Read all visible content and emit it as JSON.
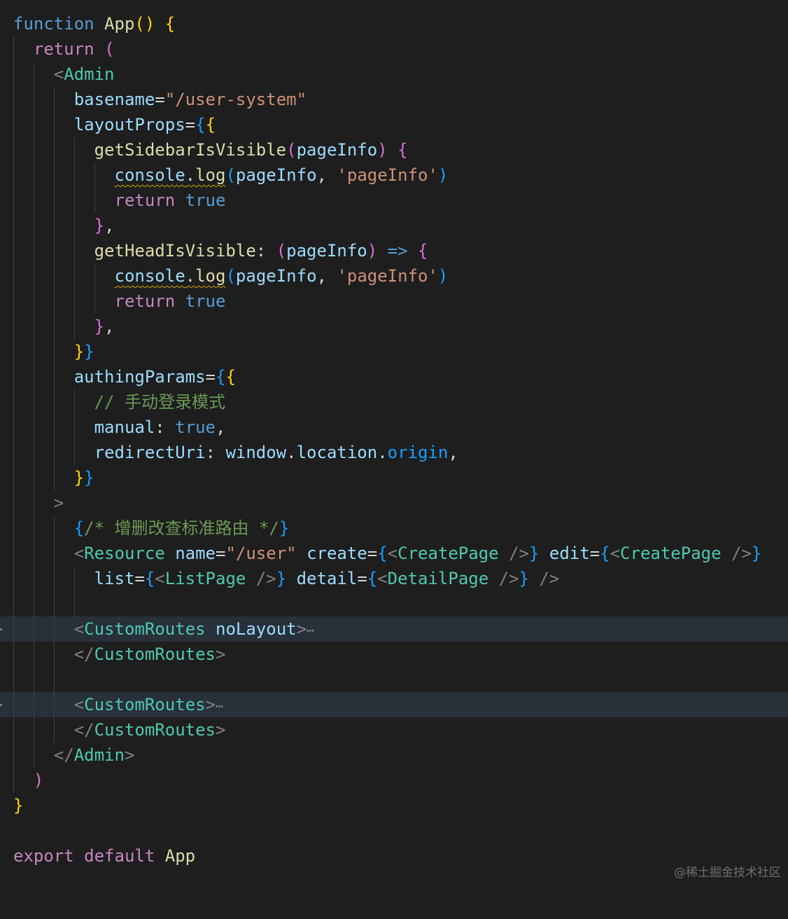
{
  "editor": {
    "language": "jsx",
    "theme": "dark",
    "line_1": {
      "kw": "function",
      "name": "App",
      "parens": "()",
      "brace": "{"
    },
    "line_2": {
      "kw": "return",
      "paren": "("
    },
    "line_3": {
      "lt": "<",
      "tag": "Admin"
    },
    "line_4": {
      "attr": "basename",
      "eq": "=",
      "value": "\"/user-system\""
    },
    "line_5": {
      "attr": "layoutProps",
      "eq": "=",
      "b1": "{",
      "b2": "{"
    },
    "line_6": {
      "name": "getSidebarIsVisible",
      "open": "(",
      "param": "pageInfo",
      "close": ")",
      "brace": "{"
    },
    "line_7": {
      "obj": "console",
      "dot": ".",
      "method": "log",
      "open": "(",
      "arg": "pageInfo",
      "comma": ",",
      "str": "'pageInfo'",
      "close": ")"
    },
    "line_8": {
      "kw": "return",
      "value": "true"
    },
    "line_9": {
      "brace": "}",
      "comma": ","
    },
    "line_10": {
      "name": "getHeadIsVisible",
      "colon": ":",
      "open": "(",
      "param": "pageInfo",
      "close": ")",
      "arrow": "=>",
      "brace": "{"
    },
    "line_11": {
      "obj": "console",
      "dot": ".",
      "method": "log",
      "open": "(",
      "arg": "pageInfo",
      "comma": ",",
      "str": "'pageInfo'",
      "close": ")"
    },
    "line_12": {
      "kw": "return",
      "value": "true"
    },
    "line_13": {
      "brace": "}",
      "comma": ","
    },
    "line_14": {
      "b1": "}",
      "b2": "}"
    },
    "line_15": {
      "attr": "authingParams",
      "eq": "=",
      "b1": "{",
      "b2": "{"
    },
    "line_16": {
      "comment": "// 手动登录模式"
    },
    "line_17": {
      "key": "manual",
      "colon": ":",
      "value": "true",
      "comma": ","
    },
    "line_18": {
      "key": "redirectUri",
      "colon": ":",
      "obj": "window",
      "dot1": ".",
      "prop1": "location",
      "dot2": ".",
      "prop2": "origin",
      "comma": ","
    },
    "line_19": {
      "b1": "}",
      "b2": "}"
    },
    "line_20": {
      "gt": ">"
    },
    "line_21": {
      "open": "{",
      "comment": "/* 增删改查标准路由 */",
      "close": "}"
    },
    "line_22": {
      "lt": "<",
      "tag": "Resource",
      "attr1": "name",
      "eq1": "=",
      "val1": "\"/user\"",
      "attr2": "create",
      "eq2": "=",
      "c_open": "{",
      "c_lt": "<",
      "c_tag": "CreatePage",
      "c_end": "/>",
      "c_close": "}",
      "attr3": "edit",
      "eq3": "=",
      "e_open": "{",
      "e_lt": "<",
      "e_tag": "CreatePage",
      "e_end": "/>",
      "e_close": "}"
    },
    "line_23": {
      "attr1": "list",
      "eq1": "=",
      "l_open": "{",
      "l_lt": "<",
      "l_tag": "ListPage",
      "l_end": "/>",
      "l_close": "}",
      "attr2": "detail",
      "eq2": "=",
      "d_open": "{",
      "d_lt": "<",
      "d_tag": "DetailPage",
      "d_end": "/>",
      "d_close": "}",
      "self_close": "/>"
    },
    "line_25": {
      "lt": "<",
      "tag": "CustomRoutes",
      "attr": "noLayout",
      "gt": ">",
      "fold": "⋯"
    },
    "line_26": {
      "lt": "</",
      "tag": "CustomRoutes",
      "gt": ">"
    },
    "line_28": {
      "lt": "<",
      "tag": "CustomRoutes",
      "gt": ">",
      "fold": "⋯"
    },
    "line_29": {
      "lt": "</",
      "tag": "CustomRoutes",
      "gt": ">"
    },
    "line_30": {
      "lt": "</",
      "tag": "Admin",
      "gt": ">"
    },
    "line_31": {
      "paren": ")"
    },
    "line_32": {
      "brace": "}"
    },
    "line_34": {
      "kw1": "export",
      "kw2": "default",
      "name": "App"
    }
  },
  "watermark": "@稀土掘金技术社区"
}
